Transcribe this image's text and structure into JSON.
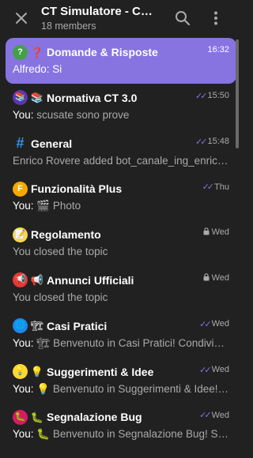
{
  "header": {
    "title": "CT Simulatore - Community",
    "subtitle": "18 members"
  },
  "topics": [
    {
      "icon_name": "question-emoji-icon",
      "icon_glyph": "?",
      "icon_color": "#43a047",
      "icon2_glyph": "❓",
      "title": "Domande & Risposte",
      "time": "16:32",
      "sender": "",
      "preview": "Alfredo: Si",
      "status": "none"
    },
    {
      "icon_name": "books-emoji-icon",
      "icon_glyph": "📚",
      "icon_color": "#5e35b1",
      "icon2_glyph": "📚",
      "title": "Normativa CT 3.0",
      "time": "15:50",
      "sender": "You:",
      "preview": " scusate sono prove",
      "status": "read"
    },
    {
      "icon_name": "hashtag-icon",
      "icon_glyph": "#",
      "icon_color": "#3390ec",
      "icon2_glyph": "",
      "title": "General",
      "time": "15:48",
      "sender": "",
      "preview": "Enrico Rovere added bot_canale_ing_enrico_rovere",
      "status": "read"
    },
    {
      "icon_name": "f-emoji-icon",
      "icon_glyph": "F",
      "icon_color": "#f6a800",
      "icon2_glyph": "",
      "title": "Funzionalità Plus",
      "time": "Thu",
      "sender": "You:",
      "preview": " 🎬 Photo",
      "status": "read"
    },
    {
      "icon_name": "memo-emoji-icon",
      "icon_glyph": "📝",
      "icon_color": "#ffd54f",
      "icon2_glyph": "",
      "title": "Regolamento",
      "time": "Wed",
      "sender": "",
      "preview": "You closed the topic",
      "status": "locked"
    },
    {
      "icon_name": "megaphone-emoji-icon",
      "icon_glyph": "📢",
      "icon_color": "#e53935",
      "icon2_glyph": "📢",
      "title": "Annunci Ufficiali",
      "time": "Wed",
      "sender": "",
      "preview": "You closed the topic",
      "status": "locked"
    },
    {
      "icon_name": "construction-emoji-icon",
      "icon_glyph": "🌐",
      "icon_color": "#1e88e5",
      "icon2_glyph": "🏗",
      "title": "Casi Pratici",
      "time": "Wed",
      "sender": "You:",
      "preview": " 🏗 Benvenuto in Casi Pratici! Condividi qui i tuoi casi",
      "status": "read"
    },
    {
      "icon_name": "lightbulb-emoji-icon",
      "icon_glyph": "💡",
      "icon_color": "#fdd835",
      "icon2_glyph": "💡",
      "title": "Suggerimenti & Idee",
      "time": "Wed",
      "sender": "You:",
      "preview": " 💡 Benvenuto in Suggerimenti & Idee! Qui puoi",
      "status": "read"
    },
    {
      "icon_name": "bug-emoji-icon",
      "icon_glyph": "🐛",
      "icon_color": "#d81b60",
      "icon2_glyph": "🐛",
      "title": "Segnalazione Bug",
      "time": "Wed",
      "sender": "You:",
      "preview": " 🐛 Benvenuto in Segnalazione Bug! Segnala qui",
      "status": "read"
    }
  ],
  "colors": {
    "background": "#212121",
    "accent": "#8774e1",
    "muted_text": "#aaaaaa"
  }
}
